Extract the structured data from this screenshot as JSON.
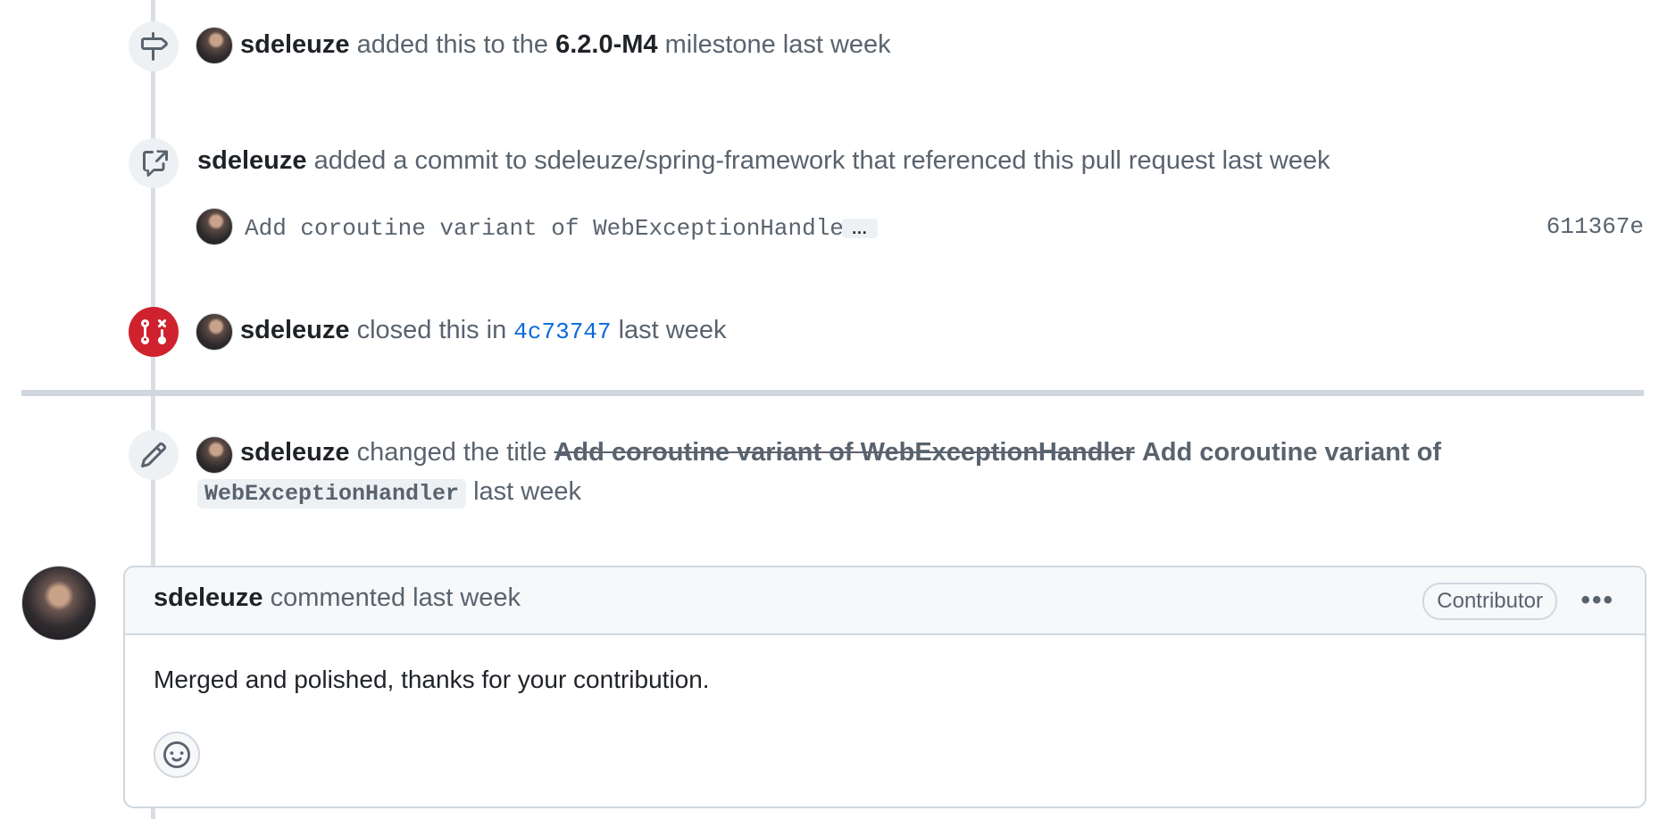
{
  "events": [
    {
      "icon": "milestone-icon",
      "user": "sdeleuze",
      "text_before": "added this to the",
      "milestone": "6.2.0-M4",
      "text_after": "milestone last week"
    },
    {
      "icon": "commit-reference-icon",
      "user": "sdeleuze",
      "text": "added a commit to sdeleuze/spring-framework that referenced this pull request last week",
      "commit": {
        "message": "Add coroutine variant of WebExceptionHandler",
        "more": "…",
        "sha": "611367e"
      }
    },
    {
      "icon": "pull-request-closed-icon",
      "user": "sdeleuze",
      "text_before": "closed this in",
      "sha": "4c73747",
      "text_after": "last week"
    },
    {
      "icon": "pencil-icon",
      "user": "sdeleuze",
      "text_before": "changed the title",
      "old_title": "Add coroutine variant of WebExceptionHandler",
      "new_title_prefix": "Add coroutine variant of",
      "new_title_code": "WebExceptionHandler",
      "text_after": "last week"
    }
  ],
  "comment": {
    "user": "sdeleuze",
    "action": "commented last week",
    "role": "Contributor",
    "menu": "•••",
    "body": "Merged and polished, thanks for your contribution.",
    "reaction_icon": "smiley-icon"
  },
  "colors": {
    "closed_red": "#cf222e",
    "link_blue": "#0969da",
    "muted": "#59636e"
  }
}
